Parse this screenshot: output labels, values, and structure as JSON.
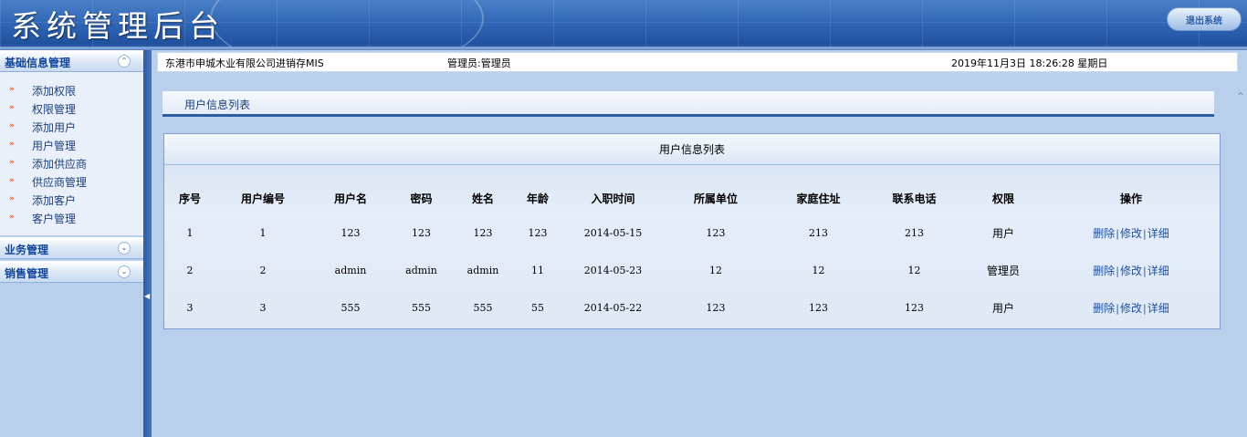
{
  "header": {
    "app_title": "系统管理后台",
    "logout_label": "退出系统"
  },
  "sidebar": {
    "groups": [
      {
        "label": "基础信息管理",
        "expanded": true,
        "items": [
          {
            "label": "添加权限"
          },
          {
            "label": "权限管理"
          },
          {
            "label": "添加用户"
          },
          {
            "label": "用户管理"
          },
          {
            "label": "添加供应商"
          },
          {
            "label": "供应商管理"
          },
          {
            "label": "添加客户"
          },
          {
            "label": "客户管理"
          }
        ]
      },
      {
        "label": "业务管理",
        "expanded": false
      },
      {
        "label": "销售管理",
        "expanded": false
      }
    ]
  },
  "top_bar": {
    "company": "东港市申城木业有限公司进销存MIS",
    "admin": "管理员:管理员",
    "datetime": "2019年11月3日  18:26:28 星期日"
  },
  "panel": {
    "tab_label": "用户信息列表",
    "title": "用户信息列表"
  },
  "table": {
    "headers": [
      "序号",
      "用户编号",
      "用户名",
      "密码",
      "姓名",
      "年龄",
      "入职时间",
      "所属单位",
      "家庭住址",
      "联系电话",
      "权限",
      "操作"
    ],
    "rows": [
      [
        "1",
        "1",
        "123",
        "123",
        "123",
        "123",
        "2014-05-15",
        "123",
        "213",
        "213",
        "用户"
      ],
      [
        "2",
        "2",
        "admin",
        "admin",
        "admin",
        "11",
        "2014-05-23",
        "12",
        "12",
        "12",
        "管理员"
      ],
      [
        "3",
        "3",
        "555",
        "555",
        "555",
        "55",
        "2014-05-22",
        "123",
        "123",
        "123",
        "用户"
      ]
    ],
    "actions": {
      "delete": "删除",
      "edit": "修改",
      "detail": "详细",
      "separator": "|"
    }
  },
  "colors": {
    "header_blue": "#2f64b4",
    "background": "#b9cfec",
    "link": "#1f4f9c",
    "bullet": "#f05a28"
  },
  "icons": {
    "menu_bullet": "double-chevron-right-icon",
    "collapse": "double-chevron-up-icon",
    "expand": "double-chevron-down-icon"
  }
}
